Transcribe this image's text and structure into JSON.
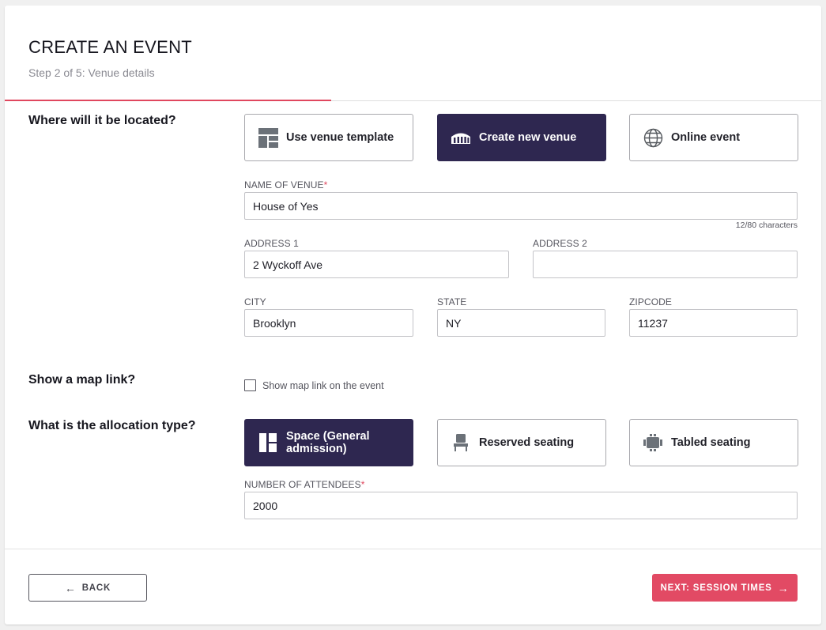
{
  "header": {
    "title": "CREATE AN EVENT",
    "subtitle": "Step 2 of 5: Venue details",
    "progress": 0.4
  },
  "location": {
    "question": "Where will it be located?",
    "options": [
      {
        "label": "Use venue template",
        "icon": "template-grid-icon",
        "selected": false
      },
      {
        "label": "Create new venue",
        "icon": "stadium-icon",
        "selected": true
      },
      {
        "label": "Online event",
        "icon": "globe-icon",
        "selected": false
      }
    ]
  },
  "venue_form": {
    "name_label": "NAME OF VENUE",
    "name_value": "House of Yes",
    "name_counter": "12/80 characters",
    "address1_label": "ADDRESS 1",
    "address1_value": "2 Wyckoff Ave",
    "address2_label": "ADDRESS 2",
    "address2_value": "",
    "city_label": "CITY",
    "city_value": "Brooklyn",
    "state_label": "STATE",
    "state_value": "NY",
    "zip_label": "ZIPCODE",
    "zip_value": "11237"
  },
  "map": {
    "question": "Show a map link?",
    "checkbox_label": "Show map link on the event",
    "checked": false
  },
  "allocation": {
    "question": "What is the allocation type?",
    "options": [
      {
        "label": "Space (General admission)",
        "icon": "general-admission-icon",
        "selected": true
      },
      {
        "label": "Reserved seating",
        "icon": "seat-icon",
        "selected": false
      },
      {
        "label": "Tabled seating",
        "icon": "table-icon",
        "selected": false
      }
    ],
    "attendees_label": "NUMBER OF ATTENDEES",
    "attendees_value": "2000"
  },
  "footer": {
    "back_label": "BACK",
    "next_label": "NEXT: SESSION TIMES"
  },
  "colors": {
    "accent": "#e24a64",
    "selected_bg": "#2e2750"
  }
}
